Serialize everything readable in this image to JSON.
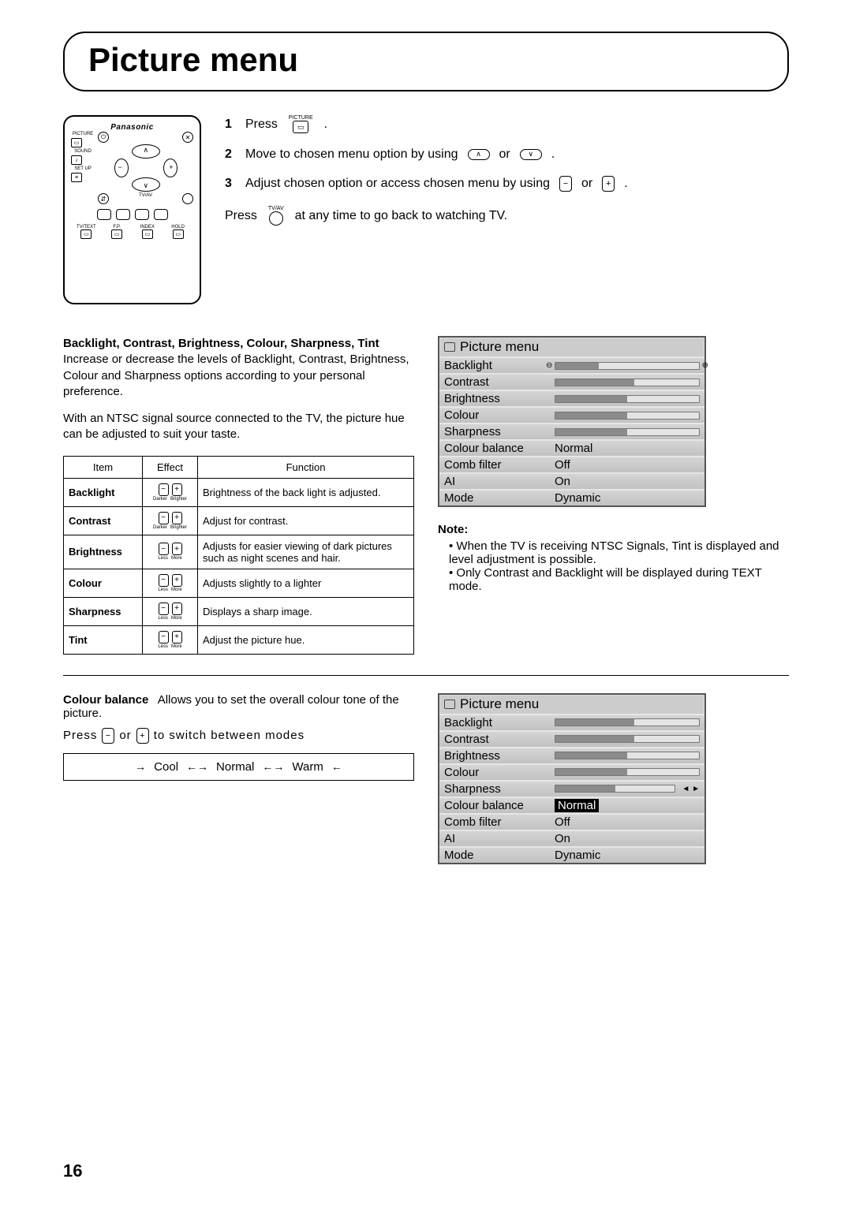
{
  "page_title": "Picture menu",
  "remote": {
    "brand": "Panasonic",
    "labels": {
      "picture": "PICTURE",
      "sound": "SOUND",
      "setup": "SET UP",
      "tvav": "TV/AV",
      "tvtext": "TV/TEXT",
      "fp": "F.P.",
      "index": "INDEX",
      "hold": "HOLD"
    }
  },
  "steps": [
    {
      "n": "1",
      "pre": "Press",
      "icon_label": "PICTURE",
      "post": "."
    },
    {
      "n": "2",
      "text_a": "Move to chosen menu option by using",
      "sep": "or",
      "post": "."
    },
    {
      "n": "3",
      "text_a": "Adjust chosen option or access chosen menu by using",
      "sep": "or",
      "post": "."
    }
  ],
  "step_return": {
    "pre": "Press",
    "icon_label": "TV/AV",
    "post": "at any time to go back to watching TV."
  },
  "adjust_heading": "Backlight, Contrast, Brightness, Colour, Sharpness, Tint",
  "adjust_para1": "Increase or decrease the levels of Backlight, Contrast, Brightness, Colour and Sharpness options according to your personal preference.",
  "adjust_para2": "With an NTSC signal source connected to the TV, the picture hue can be adjusted to suit your taste.",
  "fx_table": {
    "headers": [
      "Item",
      "Effect",
      "Function"
    ],
    "rows": [
      {
        "item": "Backlight",
        "lab_l": "Darker",
        "lab_r": "Brighter",
        "func": "Brightness of the back light is adjusted."
      },
      {
        "item": "Contrast",
        "lab_l": "Darker",
        "lab_r": "Brighter",
        "func": "Adjust for contrast."
      },
      {
        "item": "Brightness",
        "lab_l": "Less",
        "lab_r": "More",
        "func": "Adjusts for easier viewing of dark pictures such as night scenes and hair."
      },
      {
        "item": "Colour",
        "lab_l": "Less",
        "lab_r": "More",
        "func": "Adjusts slightly to a lighter"
      },
      {
        "item": "Sharpness",
        "lab_l": "Less",
        "lab_r": "More",
        "func": "Displays a sharp image."
      },
      {
        "item": "Tint",
        "lab_l": "Less",
        "lab_r": "More",
        "func": "Adjust the picture hue."
      }
    ]
  },
  "osd1": {
    "title": "Picture menu",
    "rows": [
      {
        "label": "Backlight",
        "type": "slider",
        "fill": 30,
        "decor": "pm"
      },
      {
        "label": "Contrast",
        "type": "slider",
        "fill": 55
      },
      {
        "label": "Brightness",
        "type": "slider",
        "fill": 50
      },
      {
        "label": "Colour",
        "type": "slider",
        "fill": 50
      },
      {
        "label": "Sharpness",
        "type": "slider",
        "fill": 50
      },
      {
        "label": "Colour balance",
        "type": "value",
        "val": "Normal"
      },
      {
        "label": "Comb filter",
        "type": "value",
        "val": "Off"
      },
      {
        "label": "AI",
        "type": "value",
        "val": "On"
      },
      {
        "label": "Mode",
        "type": "value",
        "val": "Dynamic"
      }
    ]
  },
  "note": {
    "title": "Note:",
    "items": [
      "When the TV is receiving NTSC Signals, Tint is displayed and level adjustment is possible.",
      "Only Contrast and Backlight will be displayed during TEXT mode."
    ]
  },
  "cb": {
    "label": "Colour balance",
    "desc": "Allows you to set the overall colour tone of the picture.",
    "press_a": "Press",
    "press_b": "or",
    "press_c": "to switch between modes",
    "modes": [
      "Cool",
      "Normal",
      "Warm"
    ]
  },
  "osd2": {
    "title": "Picture menu",
    "rows": [
      {
        "label": "Backlight",
        "type": "slider",
        "fill": 55
      },
      {
        "label": "Contrast",
        "type": "slider",
        "fill": 55
      },
      {
        "label": "Brightness",
        "type": "slider",
        "fill": 50
      },
      {
        "label": "Colour",
        "type": "slider",
        "fill": 50
      },
      {
        "label": "Sharpness",
        "type": "slider",
        "fill": 50,
        "decor": "lr"
      },
      {
        "label": "Colour balance",
        "type": "value",
        "val": "Normal",
        "selected": true
      },
      {
        "label": "Comb filter",
        "type": "value",
        "val": "Off"
      },
      {
        "label": "AI",
        "type": "value",
        "val": "On"
      },
      {
        "label": "Mode",
        "type": "value",
        "val": "Dynamic"
      }
    ]
  },
  "chart_data": [
    {
      "type": "table",
      "title": "Picture menu (OSD state 1)",
      "rows": [
        [
          "Backlight",
          "slider ~30%"
        ],
        [
          "Contrast",
          "slider ~55%"
        ],
        [
          "Brightness",
          "slider ~50%"
        ],
        [
          "Colour",
          "slider ~50%"
        ],
        [
          "Sharpness",
          "slider ~50%"
        ],
        [
          "Colour balance",
          "Normal"
        ],
        [
          "Comb filter",
          "Off"
        ],
        [
          "AI",
          "On"
        ],
        [
          "Mode",
          "Dynamic"
        ]
      ]
    },
    {
      "type": "table",
      "title": "Picture menu (OSD state 2, Colour balance selected)",
      "rows": [
        [
          "Backlight",
          "slider ~55%"
        ],
        [
          "Contrast",
          "slider ~55%"
        ],
        [
          "Brightness",
          "slider ~50%"
        ],
        [
          "Colour",
          "slider ~50%"
        ],
        [
          "Sharpness",
          "slider ~50%"
        ],
        [
          "Colour balance",
          "Normal (highlighted)"
        ],
        [
          "Comb filter",
          "Off"
        ],
        [
          "AI",
          "On"
        ],
        [
          "Mode",
          "Dynamic"
        ]
      ]
    }
  ],
  "page_number": "16"
}
